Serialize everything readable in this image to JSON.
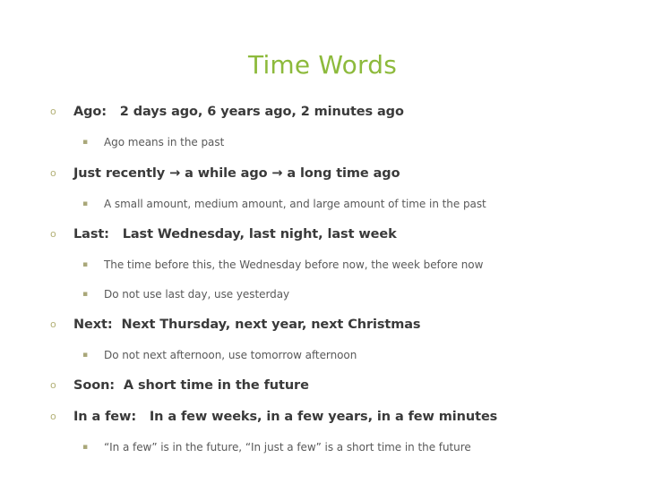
{
  "slide": {
    "title": "Time Words",
    "title_color": "#8DBA3C",
    "background_color": "#ffffff",
    "body_text_color": "#3A3A3A",
    "sub_text_color": "#595959",
    "level1_marker_glyph": "o",
    "level1_marker_color": "#B3B177",
    "level2_marker_glyph": "▪",
    "level2_marker_color": "#A9A779",
    "bullets": [
      {
        "text": "Ago:   2 days ago, 6 years ago, 2 minutes ago",
        "sub": [
          "Ago means in the past"
        ]
      },
      {
        "text": "Just recently → a while ago → a long time ago",
        "sub": [
          "A small amount, medium amount, and large amount of time in the past"
        ]
      },
      {
        "text": "Last:   Last Wednesday, last night, last week",
        "sub": [
          "The time before this, the Wednesday before now, the week before now",
          "Do not use last day, use yesterday"
        ]
      },
      {
        "text": "Next:  Next Thursday, next year, next Christmas",
        "sub": [
          "Do not next afternoon, use tomorrow afternoon"
        ]
      },
      {
        "text": "Soon:  A short time in the future",
        "sub": []
      },
      {
        "text": "In a few:   In a few weeks, in a few years, in a few minutes",
        "sub": [
          "“In a few” is in the future, “In just a few” is a short time in the future"
        ]
      }
    ]
  }
}
